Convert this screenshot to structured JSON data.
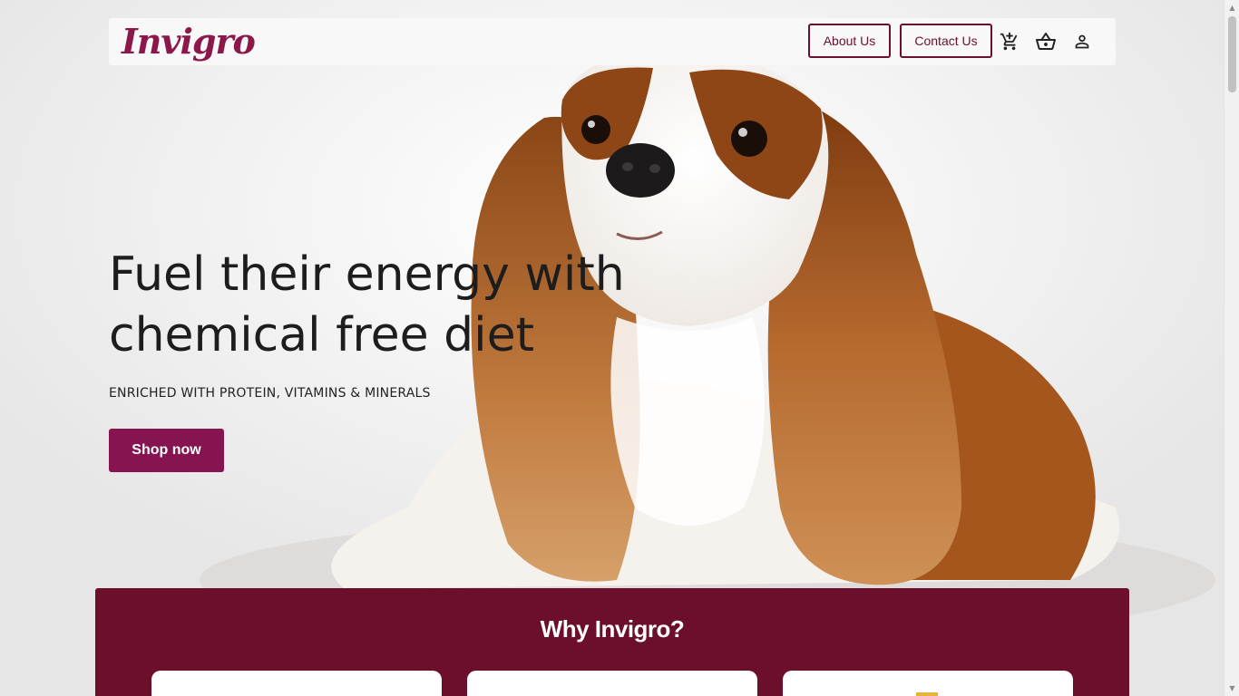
{
  "brand": {
    "logo_text": "Invigro",
    "logo_color": "#8b1848"
  },
  "nav": {
    "about_label": "About Us",
    "contact_label": "Contact Us",
    "icons": [
      "add-to-cart-icon",
      "basket-icon",
      "user-icon"
    ]
  },
  "hero": {
    "title_line1": "Fuel their energy with",
    "title_line2": "chemical free diet",
    "subtitle": "ENRICHED WITH PROTEIN, VITAMINS & MINERALS",
    "cta_label": "Shop now",
    "cta_color": "#861450",
    "image": "cavalier-king-charles-spaniel-photo"
  },
  "why_section": {
    "title": "Why Invigro?",
    "background": "#6b0f2a",
    "cards": [
      "card-1",
      "card-2",
      "card-3"
    ]
  },
  "colors": {
    "accent": "#6b0f2f",
    "card_icon": "#e8b33a"
  }
}
